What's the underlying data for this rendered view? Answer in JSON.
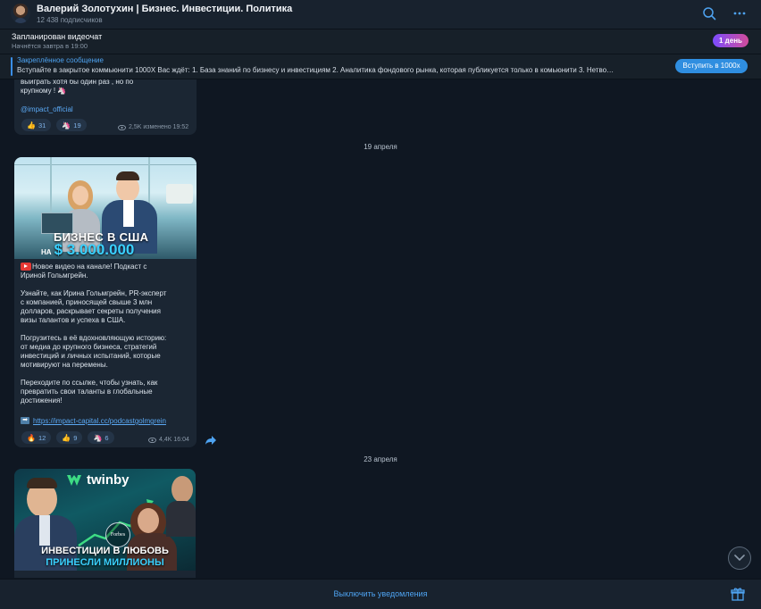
{
  "header": {
    "title": "Валерий Золотухин | Бизнес. Инвестиции. Политика",
    "subscribers": "12 438 подписчиков"
  },
  "scheduled": {
    "title": "Запланирован видеочат",
    "subtitle": "Начнётся завтра в 19:00",
    "badge": "1 день"
  },
  "pinned": {
    "label": "Закреплённое сообщение",
    "text": "Вступайте в закрытое коммьюнити 1000X   Вас ждёт:  1. База знаний по бизнесу и инвестициям  2. Аналитика фондового рынка, которая публикуется только в комьюнити 3. Нетво…",
    "button": "Вступить в 1000x"
  },
  "messages": [
    {
      "text": "выиграть хотя бы один раз , но по\nкрупному ! 🦄",
      "link": "@impact_official",
      "reactions": [
        {
          "emoji": "👍",
          "count": "31"
        },
        {
          "emoji": "🦄",
          "count": "19"
        }
      ],
      "meta": "2,5K изменено 19:52"
    },
    {
      "date": "19 апреля",
      "image_caption_line1": "БИЗНЕС В США",
      "image_caption_line2_prefix": "НА",
      "image_caption_line2": "$ 3.000.000",
      "text": "Новое видео на канале! Подкаст с\nИриной Гольмгрейн.\n\nУзнайте, как Ирина Гольмгрейн, PR-эксперт\nс компанией, приносящей свыше 3 млн\nдолларов, раскрывает секреты получения\nвизы талантов и успеха в США.\n\nПогрузитесь в её вдохновляющую историю:\nот медиа до крупного бизнеса, стратегий\nинвестиций и личных испытаний, которые\nмотивируют на перемены.\n\nПереходите по ссылке, чтобы узнать, как\nпревратить свои таланты в глобальные\nдостижения!",
      "link": "https://impact-capital.cc/podcastgolmgrein",
      "reactions": [
        {
          "emoji": "🔥",
          "count": "12"
        },
        {
          "emoji": "👍",
          "count": "9"
        },
        {
          "emoji": "🦄",
          "count": "6"
        }
      ],
      "meta": "4,4K 16:04"
    },
    {
      "date": "23 апреля",
      "brand": "twinby",
      "image_caption_line1": "ИНВЕСТИЦИИ В ЛЮБОВЬ",
      "image_caption_line2": "ПРИНЕСЛИ МИЛЛИОНЫ",
      "badge_text": "Forbes"
    }
  ],
  "bottom": {
    "mute_label": "Выключить уведомления"
  },
  "colors": {
    "accent": "#4ea3f1",
    "background": "#0f1722",
    "bubble": "#1b2633",
    "badge_gradient_start": "#7b4cff",
    "badge_gradient_end": "#d24c9a"
  }
}
